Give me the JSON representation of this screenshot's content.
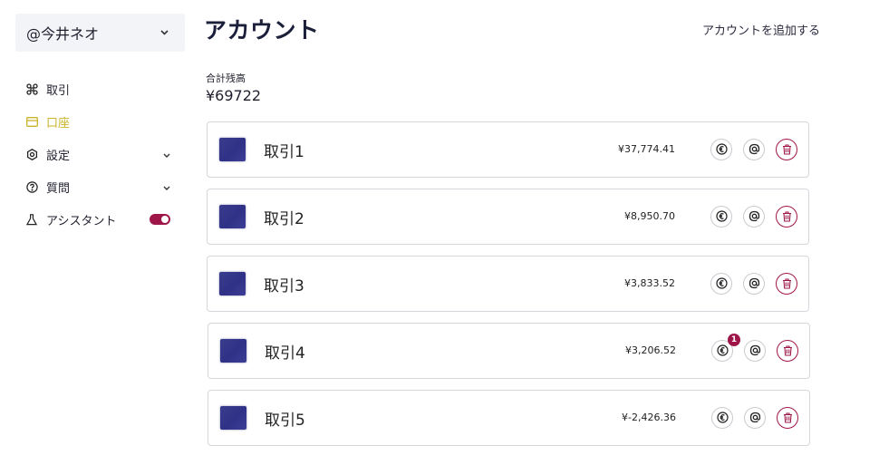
{
  "sidebar": {
    "user": "@今井ネオ",
    "items": [
      {
        "label": "取引",
        "icon": "command-icon"
      },
      {
        "label": "口座",
        "icon": "card-icon"
      },
      {
        "label": "設定",
        "icon": "gear-icon"
      },
      {
        "label": "質問",
        "icon": "question-icon"
      },
      {
        "label": "アシスタント",
        "icon": "flask-icon"
      }
    ]
  },
  "main": {
    "title": "アカウント",
    "add_link": "アカウントを追加する",
    "total_label": "合計残高",
    "total_value": "¥69722"
  },
  "accounts": [
    {
      "name": "取引1",
      "balance": "¥37,774.41",
      "badge": ""
    },
    {
      "name": "取引2",
      "balance": "¥8,950.70",
      "badge": ""
    },
    {
      "name": "取引3",
      "balance": "¥3,833.52",
      "badge": ""
    },
    {
      "name": "取引4",
      "balance": "¥3,206.52",
      "badge": "1"
    },
    {
      "name": "取引5",
      "balance": "¥-2,426.36",
      "badge": ""
    }
  ],
  "colors": {
    "accent": "#9e1548",
    "active_nav": "#c9b42a",
    "title": "#1c1f3a"
  }
}
